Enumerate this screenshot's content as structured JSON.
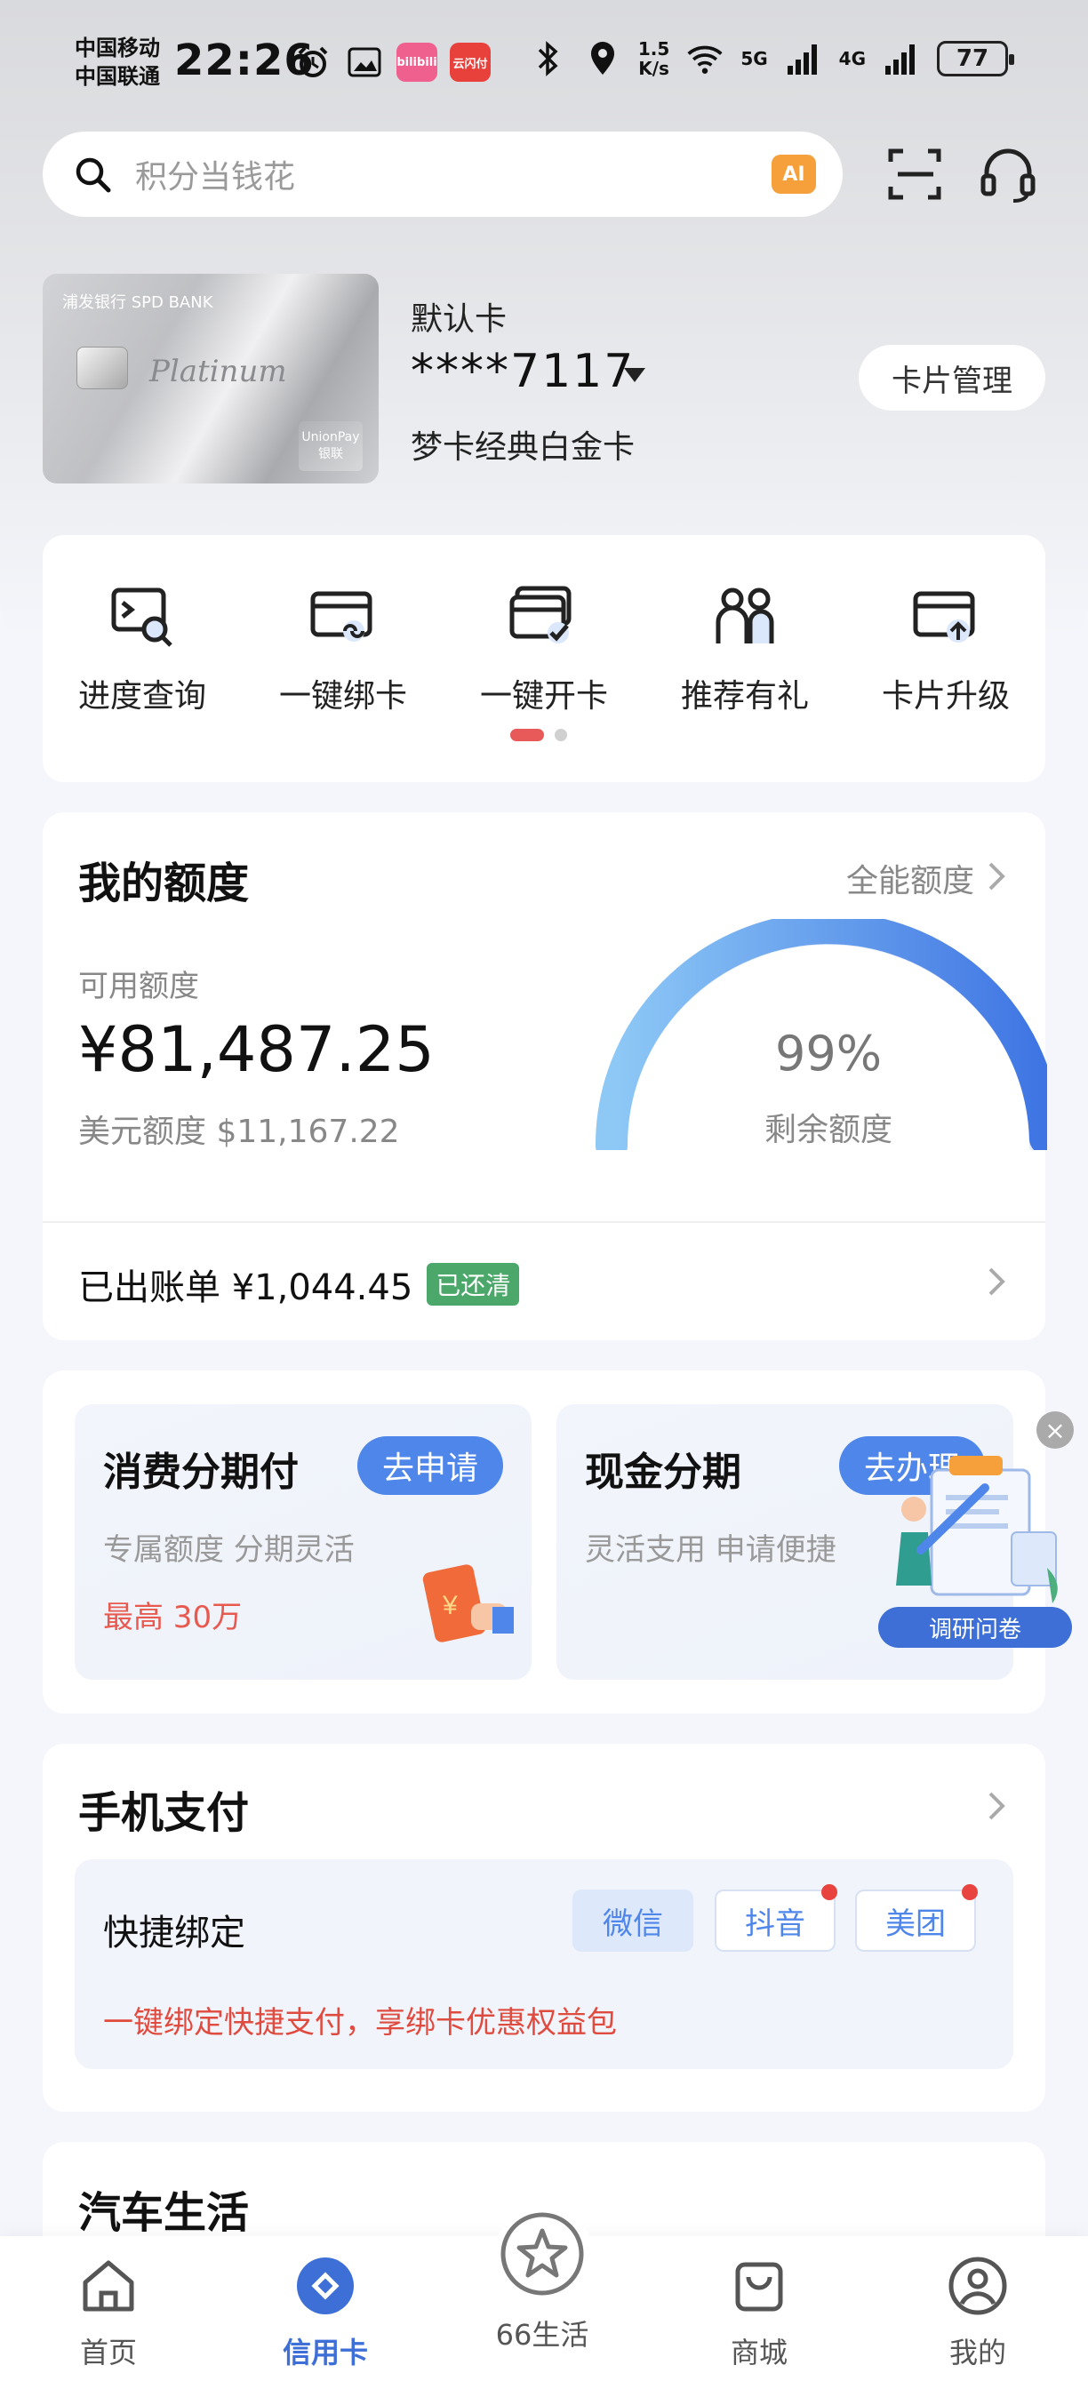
{
  "status_bar": {
    "carrier_1": "中国移动",
    "carrier_2": "中国联通",
    "time": "22:26",
    "app_badge_1": "bilibili",
    "app_badge_2": "云闪付",
    "speed_value": "1.5",
    "speed_unit": "K/s",
    "net_5g": "5G",
    "net_4g": "4G",
    "battery": "77"
  },
  "search": {
    "placeholder": "积分当钱花",
    "ai_label": "AI"
  },
  "card": {
    "bank_name": "浦发银行 SPD BANK",
    "script": "Platinum",
    "union_label": "UnionPay 银联",
    "default_label": "默认卡",
    "number": "****7117",
    "name": "梦卡经典白金卡",
    "manage_label": "卡片管理"
  },
  "quick_functions": [
    {
      "label": "进度查询",
      "icon": "progress-search-icon"
    },
    {
      "label": "一键绑卡",
      "icon": "bind-card-icon"
    },
    {
      "label": "一键开卡",
      "icon": "open-card-icon"
    },
    {
      "label": "推荐有礼",
      "icon": "refer-friends-icon"
    },
    {
      "label": "卡片升级",
      "icon": "card-upgrade-icon"
    }
  ],
  "credit": {
    "title": "我的额度",
    "all_link": "全能额度",
    "available_label": "可用额度",
    "available_amount": "¥81,487.25",
    "usd_line": "美元额度 $11,167.22",
    "remaining_percent": "99%",
    "remaining_fraction": 0.99,
    "remaining_label": "剩余额度",
    "bill_text": "已出账单 ¥1,044.45",
    "bill_status": "已还清"
  },
  "installments": [
    {
      "title": "消费分期付",
      "button": "去申请",
      "subtitle": "专属额度  分期灵活",
      "highlight": "最高  30万"
    },
    {
      "title": "现金分期",
      "button": "去办理",
      "subtitle": "灵活支用  申请便捷"
    }
  ],
  "survey": {
    "close": "×",
    "label": "调研问卷"
  },
  "mobile_pay": {
    "title": "手机支付",
    "quickbind_label": "快捷绑定",
    "tags": [
      "微信",
      "抖音",
      "美团"
    ],
    "promo": "一键绑定快捷支付，享绑卡优惠权益包"
  },
  "car_life": {
    "title": "汽车生活"
  },
  "bottom_nav": [
    {
      "label": "首页",
      "icon": "home-icon"
    },
    {
      "label": "信用卡",
      "icon": "credit-card-icon",
      "active": true
    },
    {
      "label": "66生活",
      "icon": "star-icon"
    },
    {
      "label": "商城",
      "icon": "shopping-bag-icon"
    },
    {
      "label": "我的",
      "icon": "profile-icon"
    }
  ],
  "colors": {
    "accent_blue": "#3d6fd6",
    "gauge_start": "#8ec9f6",
    "gauge_end": "#3e74e3",
    "alert_red": "#e04b3f",
    "paid_green": "#4ca86a"
  }
}
